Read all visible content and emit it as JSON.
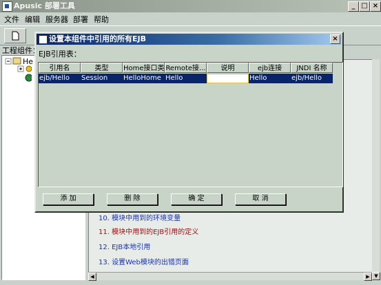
{
  "app": {
    "title": "Apusic 部署工具",
    "window_buttons": {
      "minimize": "_",
      "maximize": "□",
      "close": "×"
    }
  },
  "menu": [
    "文件",
    "编辑",
    "服务器",
    "部署",
    "帮助"
  ],
  "project_panel": {
    "label": "工程组件：",
    "tree_root": "He"
  },
  "right_panel": {
    "links": [
      {
        "text": "10. 模块中用到的环境变量",
        "color": "#1a32b4"
      },
      {
        "text": "11. 模块中用到的EJB引用的定义",
        "color": "#a01010"
      },
      {
        "text": "12. EJB本地引用",
        "color": "#1a32b4"
      },
      {
        "text": "13. 设置Web模块的出错页面",
        "color": "#1a32b4"
      }
    ]
  },
  "dialog": {
    "title": "设置本组件中引用的所有EJB",
    "close": "×",
    "table_label": "EJB引用表：",
    "columns": [
      "引用名",
      "类型",
      "Home接口类",
      "Remote接...",
      "说明",
      "ejb连接",
      "JNDI 名称"
    ],
    "rows": [
      [
        "ejb/Hello",
        "Session",
        "HelloHome",
        "Hello",
        "",
        "Hello",
        "ejb/Hello"
      ]
    ],
    "buttons": {
      "add": "添 加",
      "delete": "删 除",
      "ok": "确 定",
      "cancel": "取 消"
    }
  },
  "colors": {
    "selection": "#0a246a",
    "dialog_title_start": "#0a246a",
    "dialog_title_end": "#a6caf0"
  }
}
